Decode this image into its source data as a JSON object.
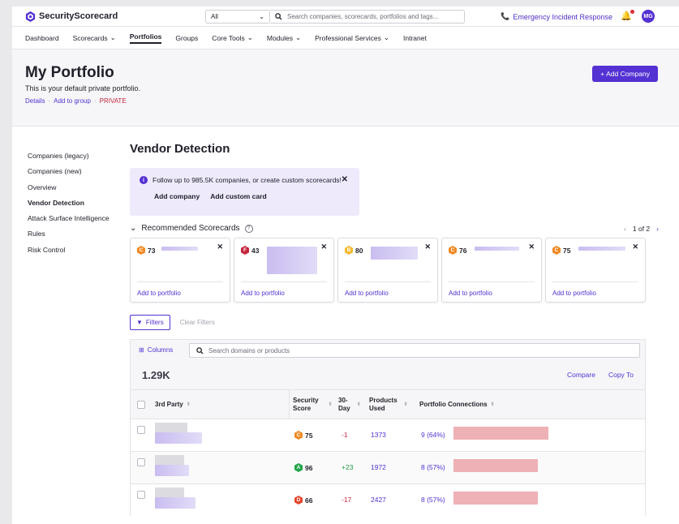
{
  "app": {
    "brand": "SecurityScorecard"
  },
  "topbar": {
    "scope_value": "All",
    "search_placeholder": "Search companies, scorecards, portfolios and tags...",
    "emergency_label": "Emergency Incident Response",
    "avatar_initials": "MG"
  },
  "nav": {
    "items": [
      "Dashboard",
      "Scorecards",
      "Portfolios",
      "Groups",
      "Core Tools",
      "Modules",
      "Professional Services",
      "Intranet"
    ]
  },
  "header": {
    "title": "My Portfolio",
    "subtitle": "This is your default private portfolio.",
    "details": "Details",
    "add_to_group": "Add to group",
    "private": "PRIVATE",
    "add_company_button": "+ Add Company"
  },
  "sidebar": {
    "items": [
      "Companies (legacy)",
      "Companies (new)",
      "Overview",
      "Vendor Detection",
      "Attack Surface Intelligence",
      "Rules",
      "Risk Control"
    ]
  },
  "main": {
    "title": "Vendor Detection",
    "banner": {
      "text": "Follow up to 985.5K companies, or create custom scorecards!",
      "add_company": "Add company",
      "add_custom_card": "Add custom card"
    },
    "recommended": {
      "title": "Recommended Scorecards",
      "pager": "1 of 2",
      "add_label": "Add to portfolio",
      "cards": [
        {
          "grade": "C",
          "score": "73",
          "color": "#f08a24"
        },
        {
          "grade": "F",
          "score": "43",
          "color": "#c6243b"
        },
        {
          "grade": "B",
          "score": "80",
          "color": "#f5b82e"
        },
        {
          "grade": "C",
          "score": "76",
          "color": "#f08a24"
        },
        {
          "grade": "C",
          "score": "75",
          "color": "#f08a24"
        }
      ]
    },
    "filters": {
      "button": "Filters",
      "clear": "Clear Filters"
    },
    "table": {
      "columns_button": "Columns",
      "search_placeholder": "Search domains or products",
      "count": "1.29K",
      "compare": "Compare",
      "copy_to": "Copy To",
      "headers": {
        "third_party": "3rd Party",
        "security_score_1": "Security",
        "security_score_2": "Score",
        "day30_1": "30-",
        "day30_2": "Day",
        "products_1": "Products",
        "products_2": "Used",
        "connections": "Portfolio Connections"
      },
      "rows": [
        {
          "grade": "C",
          "score": "75",
          "color": "#f08a24",
          "change": "-1",
          "products": "1373",
          "connections": "9 (64%)",
          "connections_pct": 64
        },
        {
          "grade": "A",
          "score": "96",
          "color": "#22a447",
          "change": "+23",
          "products": "1972",
          "connections": "8 (57%)",
          "connections_pct": 57
        },
        {
          "grade": "D",
          "score": "66",
          "color": "#e2462c",
          "change": "-17",
          "products": "2427",
          "connections": "8 (57%)",
          "connections_pct": 57
        }
      ]
    }
  }
}
